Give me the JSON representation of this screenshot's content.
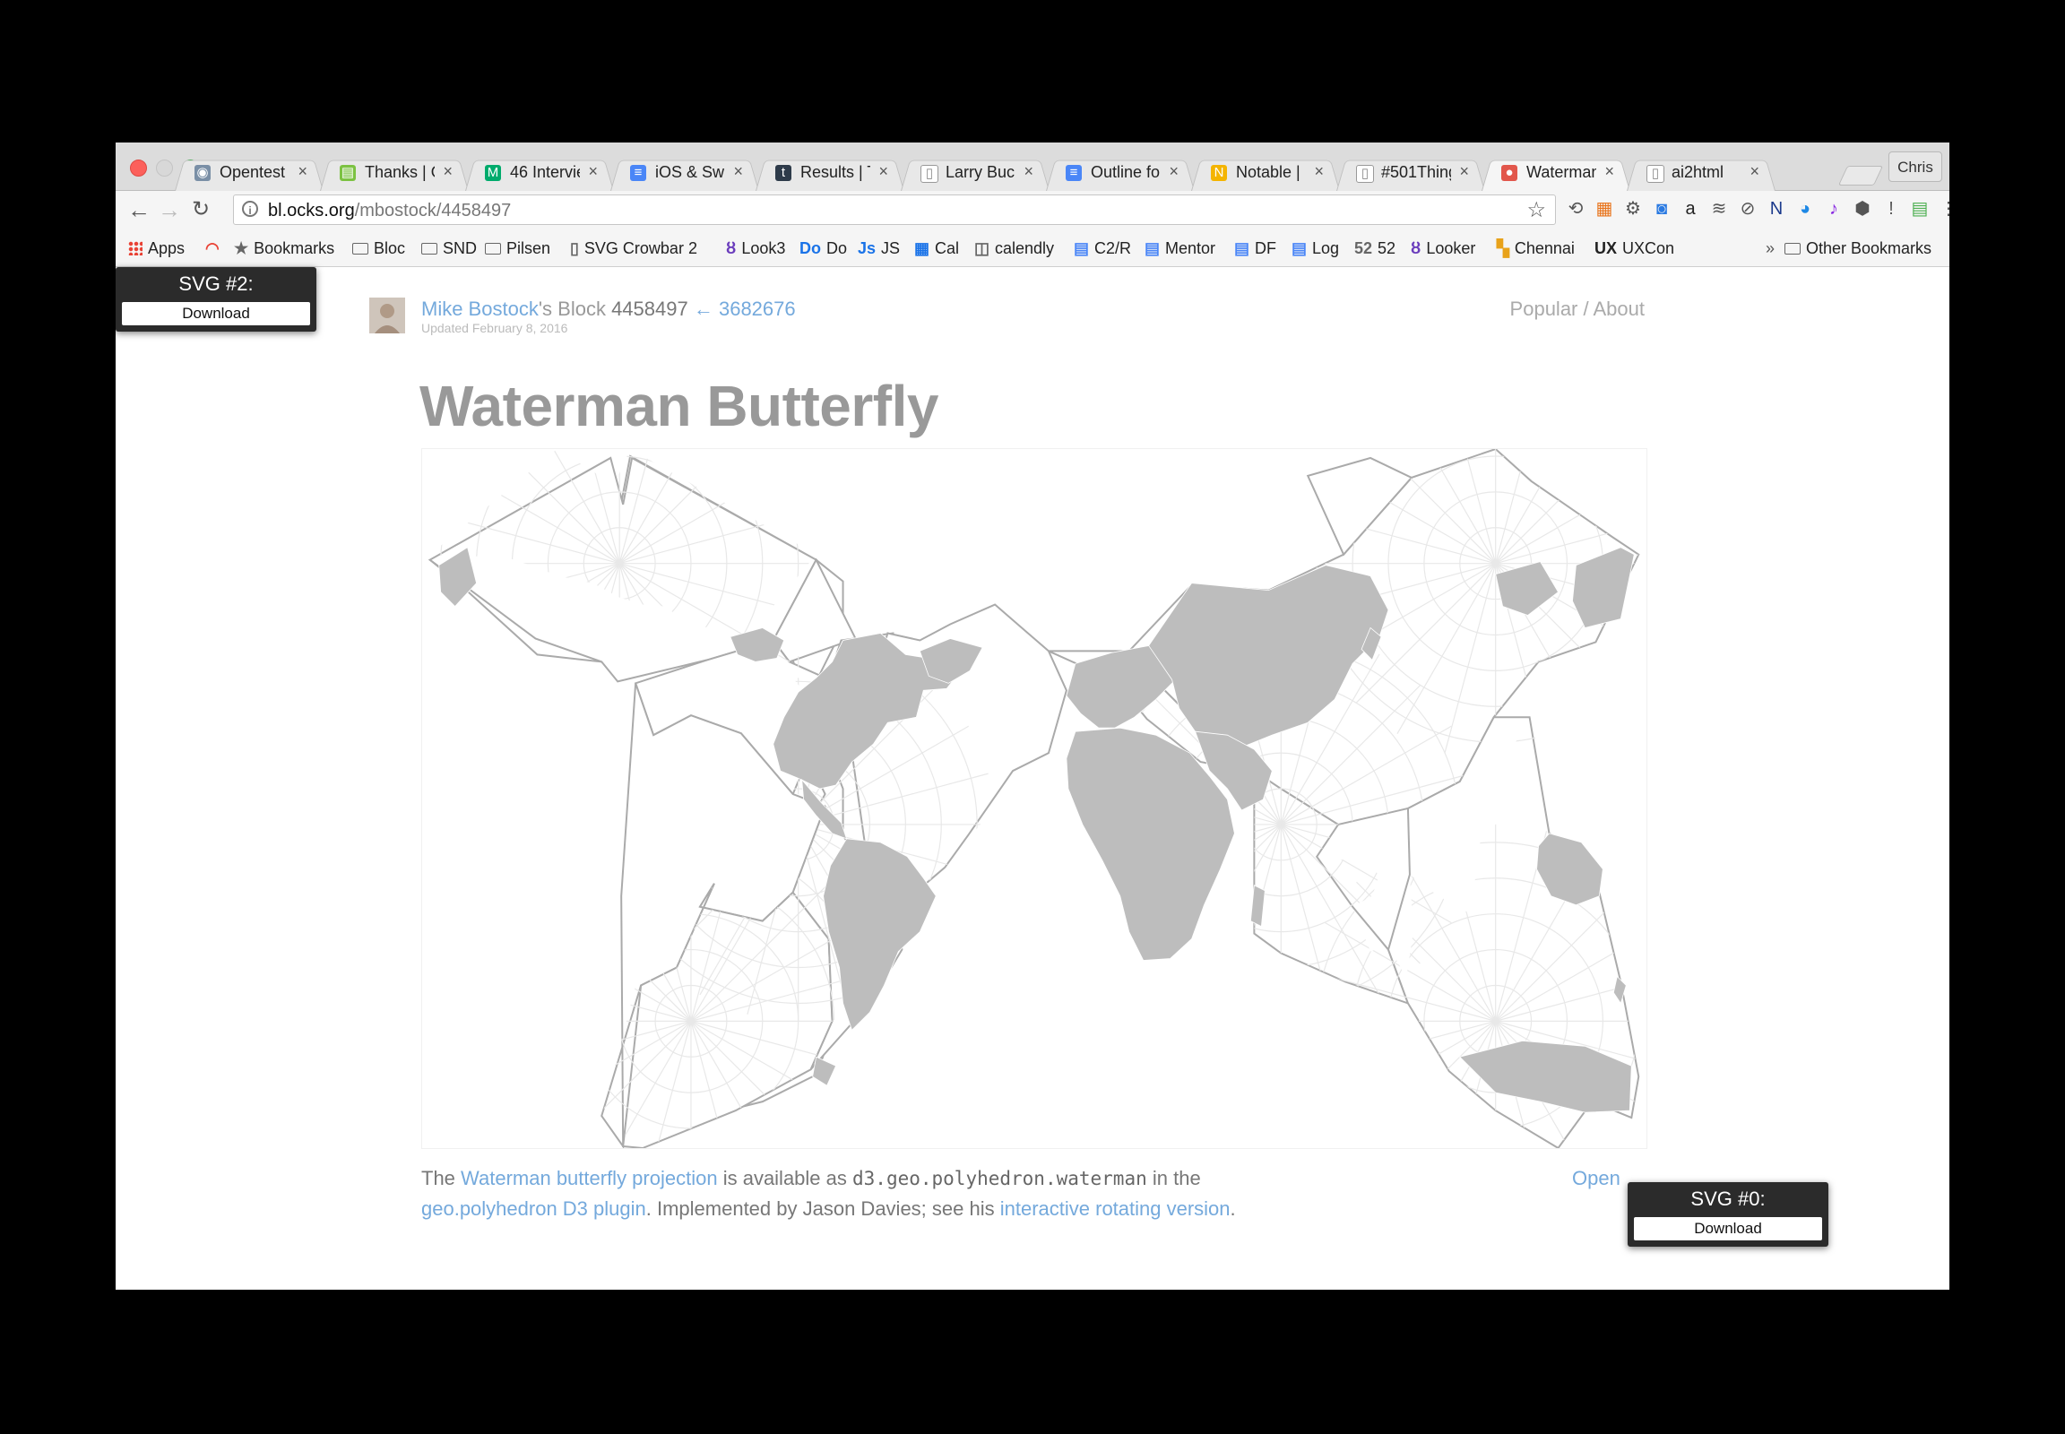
{
  "browser": {
    "tabs": [
      {
        "title": "Opentest -",
        "fav_color": "#7a8fa6",
        "fav": "◉",
        "active": false
      },
      {
        "title": "Thanks | O",
        "fav_color": "#7cc242",
        "fav": "▤",
        "active": false
      },
      {
        "title": "46 Intervie",
        "fav_color": "#00ab6c",
        "fav": "M",
        "active": false
      },
      {
        "title": "iOS & Swift",
        "fav_color": "#4a86f7",
        "fav": "≡",
        "active": false
      },
      {
        "title": "Results | T",
        "fav_color": "#2e3b4a",
        "fav": "t",
        "active": false
      },
      {
        "title": "Larry Buch",
        "fav_color": "#ffffff",
        "fav": "▯",
        "active": false
      },
      {
        "title": "Outline for",
        "fav_color": "#4a86f7",
        "fav": "≡",
        "active": false
      },
      {
        "title": "Notable | H",
        "fav_color": "#f4b400",
        "fav": "N",
        "active": false
      },
      {
        "title": "#501Thing",
        "fav_color": "#ffffff",
        "fav": "▯",
        "active": false
      },
      {
        "title": "Waterman",
        "fav_color": "#e2574c",
        "fav": "●",
        "active": true
      },
      {
        "title": "ai2html",
        "fav_color": "#ffffff",
        "fav": "▯",
        "active": false
      }
    ],
    "close_glyph": "×",
    "profile": "Chris",
    "url_host": "bl.ocks.org",
    "url_path": "/mbostock/4458497",
    "extension_icons": [
      "sync-icon",
      "new-badge-icon",
      "gear-icon",
      "notification-icon",
      "amazon-icon",
      "buffer-icon",
      "disable-icon",
      "n-icon",
      "globe-icon",
      "music-icon",
      "hexagon-icon",
      "exclamation-icon",
      "sheet-icon",
      "menu-icon"
    ],
    "bookmarks": [
      {
        "label": "Apps",
        "icon": "apps-grid-icon"
      },
      {
        "label": "",
        "icon": "rainbow-icon"
      },
      {
        "label": "Bookmarks",
        "icon": "star-icon"
      },
      {
        "label": "Bloc",
        "icon": "folder-icon"
      },
      {
        "label": "SND",
        "icon": "folder-icon"
      },
      {
        "label": "Pilsen",
        "icon": "folder-icon"
      },
      {
        "label": "SVG Crowbar 2",
        "icon": "page-icon"
      },
      {
        "label": "Look3",
        "icon": "looker-icon"
      },
      {
        "label": "Do",
        "icon": "do-icon"
      },
      {
        "label": "JS",
        "icon": "js-icon"
      },
      {
        "label": "Cal",
        "icon": "calendar-icon"
      },
      {
        "label": "calendly",
        "icon": "calendly-icon"
      },
      {
        "label": "C2/R",
        "icon": "doc-icon"
      },
      {
        "label": "Mentor",
        "icon": "doc-icon"
      },
      {
        "label": "DF",
        "icon": "doc-icon"
      },
      {
        "label": "Log",
        "icon": "doc-icon"
      },
      {
        "label": "52",
        "icon": "fifty-two-icon"
      },
      {
        "label": "Looker",
        "icon": "looker-icon"
      },
      {
        "label": "Chennai",
        "icon": "grid-color-icon"
      },
      {
        "label": "UXCon",
        "icon": "ux-icon"
      }
    ],
    "overflow_chevron": "»",
    "other_bookmarks": "Other Bookmarks"
  },
  "page": {
    "author": "Mike Bostock",
    "byline_mid": "'s Block",
    "block_id": "4458497",
    "arrow": "←",
    "parent_id": "3682676",
    "updated": "Updated February 8, 2016",
    "nav": "Popular / About",
    "title": "Waterman Butterfly",
    "desc": {
      "the": "The",
      "link1": "Waterman butterfly projection",
      "t1": "is available as",
      "code": "d3.geo.polyhedron.waterman",
      "t2": "in the",
      "link2": "geo.polyhedron D3 plugin",
      "t3": ". Implemented by Jason Davies; see his",
      "link3": "interactive rotating version",
      "t4": "."
    },
    "open": "Open"
  },
  "crowbar": {
    "top": {
      "label": "SVG #2:",
      "button": "Download"
    },
    "bottom": {
      "label": "SVG #0:",
      "button": "Download"
    }
  },
  "colors": {
    "land": "#bdbdbd",
    "graticule": "#e8e8e8",
    "outline": "#aaaaaa",
    "link": "#74a9dc"
  }
}
